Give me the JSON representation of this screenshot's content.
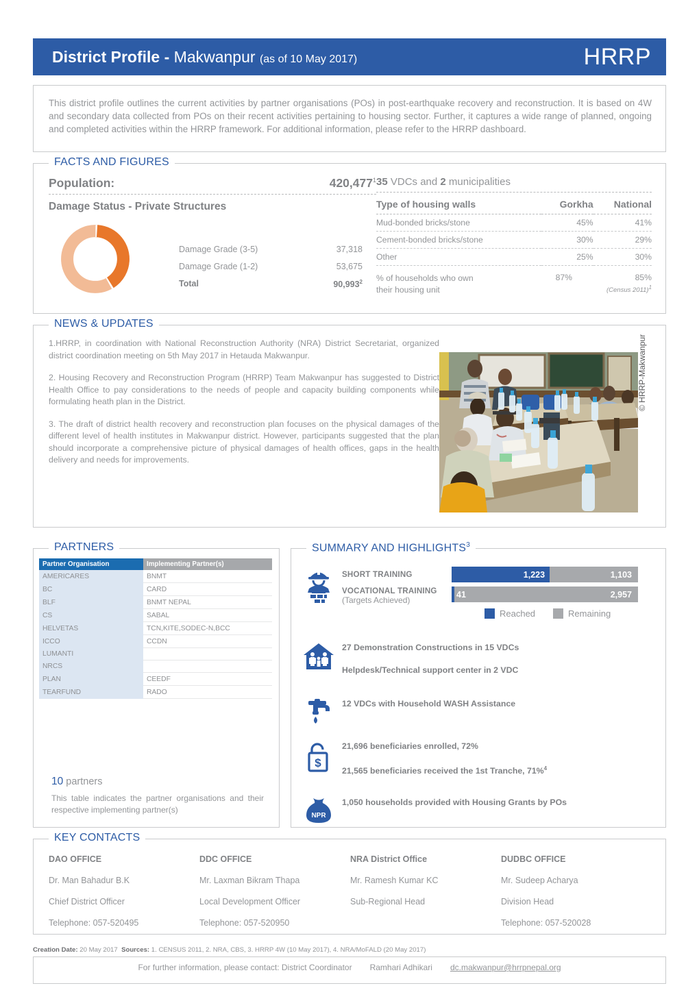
{
  "header": {
    "title_bold": "District Profile -",
    "district": "Makwanpur",
    "date_note": "(as of 10 May 2017)",
    "logo": "HRRP",
    "bar_color": "#2d5ca6"
  },
  "intro": {
    "text": "This district profile outlines the current activities by partner organisations (POs) in post-earthquake recovery and reconstruction. It is based on 4W and secondary data collected from POs on their recent activities pertaining to housing sector. Further, it captures a wide range of planned, ongoing and completed activities within the HRRP framework. For additional information, please refer to the HRRP dashboard."
  },
  "facts": {
    "section_title": "FACTS AND FIGURES",
    "population_label": "Population:",
    "population_value": "420,477",
    "population_sup": "1",
    "damage_title": "Damage Status - Private Structures",
    "damage_rows": [
      {
        "label": "Damage Grade (3-5)",
        "value": "37,318"
      },
      {
        "label": "Damage Grade (1-2)",
        "value": "53,675"
      }
    ],
    "total_label": "Total",
    "total_value": "90,993",
    "total_sup": "2",
    "vdc_count": "35",
    "vdc_text": "VDCs and",
    "muni_count": "2",
    "muni_text": "municipalities",
    "walls_headers": [
      "Type of housing walls",
      "Gorkha",
      "National"
    ],
    "walls_rows": [
      {
        "type": "Mud-bonded bricks/stone",
        "gorkha": "45%",
        "national": "41%"
      },
      {
        "type": "Cement-bonded bricks/stone",
        "gorkha": "30%",
        "national": "29%"
      },
      {
        "type": "Other",
        "gorkha": "25%",
        "national": "30%"
      }
    ],
    "own_label_1": "% of households who own",
    "own_label_2": "their housing unit",
    "own_gorkha": "87%",
    "own_national": "85%",
    "census_note": "(Census 2011)"
  },
  "chart_data": [
    {
      "type": "pie",
      "title": "Damage Status - Private Structures",
      "labels": [
        "Damage Grade (3-5)",
        "Damage Grade (1-2)"
      ],
      "values": [
        37318,
        53675
      ],
      "percents": [
        41,
        59
      ],
      "colors": [
        "#e8772a",
        "#f2bb96"
      ],
      "total": 90993,
      "donut": true
    },
    {
      "type": "bar",
      "title": "Targets Achieved",
      "orientation": "horizontal",
      "stacked": true,
      "categories": [
        "SHORT TRAINING",
        "VOCATIONAL TRAINING"
      ],
      "series": [
        {
          "name": "Reached",
          "values": [
            1223,
            41
          ],
          "color": "#2d5ca6"
        },
        {
          "name": "Remaining",
          "values": [
            1103,
            2957
          ],
          "color": "#a7a9ac"
        }
      ],
      "reached_pct": [
        52.6,
        1.4
      ],
      "legend_position": "bottom"
    },
    {
      "type": "table",
      "title": "Type of housing walls",
      "columns": [
        "Type of housing walls",
        "Gorkha",
        "National"
      ],
      "rows": [
        [
          "Mud-bonded bricks/stone",
          "45%",
          "41%"
        ],
        [
          "Cement-bonded bricks/stone",
          "30%",
          "29%"
        ],
        [
          "Other",
          "25%",
          "30%"
        ],
        [
          "% of households who own their housing unit",
          "87%",
          "85%"
        ]
      ]
    }
  ],
  "news": {
    "section_title": "NEWS & UPDATES",
    "items": [
      "1.HRRP, in coordination with National Reconstruction Authority (NRA) District Secretariat, organized district coordination meeting on 5th May 2017 in Hetauda Makwanpur.",
      "2.  Housing Recovery and Reconstruction Program (HRRP) Team Makwanpur has suggested to District Health Office to pay considerations to the needs of people and capacity building components while formulating heath plan in the District.",
      "3. The draft of district health recovery and reconstruction plan focuses on the physical damages of the different level of health institutes in Makwanpur district. However, participants suggested that the plan should incorporate a comprehensive picture of physical damages of health offices, gaps in the health delivery and needs for improvements."
    ],
    "photo_credit": "© HRRP-Makwanpur"
  },
  "partners": {
    "section_title": "PARTNERS",
    "columns": [
      "Partner Organisation",
      "Implementing Partner(s)"
    ],
    "rows": [
      {
        "po": "AMERICARES",
        "ip": "BNMT"
      },
      {
        "po": "BC",
        "ip": "CARD"
      },
      {
        "po": "BLF",
        "ip": "BNMT NEPAL"
      },
      {
        "po": "CS",
        "ip": "SABAL"
      },
      {
        "po": "HELVETAS",
        "ip": "TCN,KITE,SODEC-N,BCC"
      },
      {
        "po": "ICCO",
        "ip": "CCDN"
      },
      {
        "po": "LUMANTI",
        "ip": ""
      },
      {
        "po": "NRCS",
        "ip": ""
      },
      {
        "po": "PLAN",
        "ip": "CEEDF"
      },
      {
        "po": "TEARFUND",
        "ip": "RADO"
      }
    ],
    "count": "10",
    "count_label": "partners",
    "note": "This table indicates the partner organisations and their respective implementing partner(s)"
  },
  "summary": {
    "section_title": "SUMMARY AND HIGHLIGHTS",
    "section_sup": "3",
    "short_training_label": "SHORT TRAINING",
    "short_reached": "1,223",
    "short_remaining": "1,103",
    "vocational_label": "VOCATIONAL TRAINING",
    "vocational_sub": "(Targets Achieved)",
    "vocational_reached": "41",
    "vocational_remaining": "2,957",
    "legend_reached": "Reached",
    "legend_remaining": "Remaining",
    "demo_line1": "27 Demonstration Constructions in 15 VDCs",
    "demo_line2": "Helpdesk/Technical support center in 2 VDC",
    "wash_line": "12 VDCs with Household WASH Assistance",
    "grant_line1": "21,696 beneficiaries enrolled, 72%",
    "grant_line2": "21,565 beneficiaries received the 1st Tranche, 71%",
    "grant_line2_sup": "4",
    "npr_badge": "NPR",
    "npr_line": "1,050 households provided with Housing Grants by POs"
  },
  "contacts": {
    "section_title": "KEY CONTACTS",
    "columns": [
      {
        "office": "DAO OFFICE",
        "name": "Dr. Man Bahadur B.K",
        "role": "Chief District Officer",
        "phone": "Telephone: 057-520495"
      },
      {
        "office": "DDC OFFICE",
        "name": "Mr. Laxman Bikram Thapa",
        "role": "Local Development Officer",
        "phone": "Telephone: 057-520950"
      },
      {
        "office": "NRA District Office",
        "name": "Mr. Ramesh Kumar KC",
        "role": "Sub-Regional Head",
        "phone": ""
      },
      {
        "office": "DUDBC OFFICE",
        "name": "Mr. Sudeep Acharya",
        "role": "Division Head",
        "phone": "Telephone: 057-520028"
      }
    ]
  },
  "footer": {
    "creation_label": "Creation Date:",
    "creation_date": "20 May 2017",
    "sources_label": "Sources:",
    "sources": "1. CENSUS 2011, 2. NRA, CBS, 3. HRRP 4W (10 May 2017), 4. NRA/MoFALD (20 May 2017)",
    "contact_text": "For further information, please contact: District Coordinator",
    "coordinator": "Ramhari Adhikari",
    "email": "dc.makwanpur@hrrpnepal.org"
  }
}
